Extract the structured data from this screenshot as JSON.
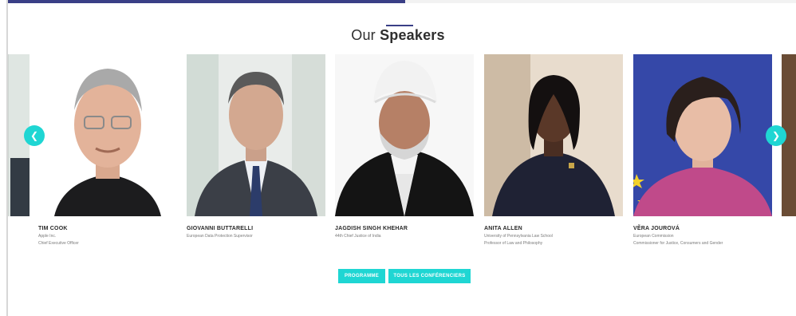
{
  "section": {
    "title_part1": "Our",
    "title_part2": "Speakers"
  },
  "speakers": [
    {
      "name": "TIM COOK",
      "role_line1": "Apple Inc.",
      "role_line2": "Chief Executive Officer"
    },
    {
      "name": "GIOVANNI BUTTARELLI",
      "role_line1": "European Data Protection Supervisor",
      "role_line2": ""
    },
    {
      "name": "JAGDISH SINGH KHEHAR",
      "role_line1": "44th Chief Justice of India",
      "role_line2": ""
    },
    {
      "name": "ANITA ALLEN",
      "role_line1": "University of Pennsylvania Law School",
      "role_line2": "Professor of Law and Philosophy"
    },
    {
      "name": "VĚRA JOUROVÁ",
      "role_line1": "European Commission",
      "role_line2": "Commissioner for Justice, Consumers and Gender"
    }
  ],
  "buttons": {
    "programme": "PROGRAMME",
    "conferences": "TOUS LES CONFÉRENCIERS"
  },
  "icons": {
    "prev": "chevron-left-icon",
    "next": "chevron-right-icon"
  },
  "colors": {
    "accent": "#1fd6d3",
    "brand": "#3a3f86"
  }
}
